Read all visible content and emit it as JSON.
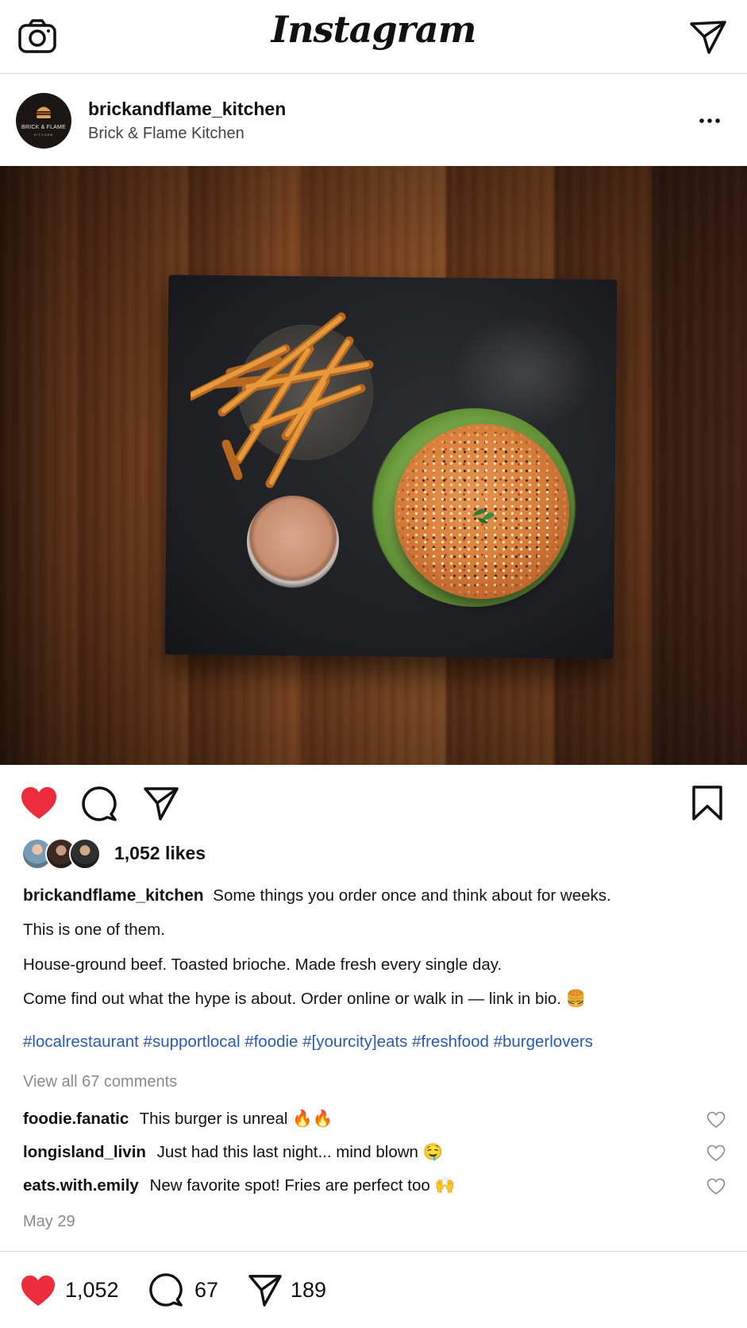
{
  "app": {
    "title": "Instagram"
  },
  "header": {
    "camera_icon": "camera-icon",
    "send_icon": "direct-send-icon"
  },
  "post": {
    "username": "brickandflame_kitchen",
    "display_name": "Brick & Flame Kitchen",
    "avatar_brand": "BRICK & FLAME",
    "avatar_brand_sub": "KITCHEN",
    "likes_text": "1,052 likes",
    "caption": {
      "username": "brickandflame_kitchen",
      "line1": "Some things you order once and think about for weeks.",
      "line2": "This is one of them.",
      "line3": "House-ground beef. Toasted brioche. Made fresh every single day.",
      "line4": "Come find out what the hype is about. Order online or walk in — link in bio. 🍔"
    },
    "hashtags": "#localrestaurant #supportlocal #foodie #[yourcity]eats #freshfood #burgerlovers",
    "view_all_comments": "View all 67 comments",
    "comments": [
      {
        "user": "foodie.fanatic",
        "text": "This burger is unreal 🔥🔥"
      },
      {
        "user": "longisland_livin",
        "text": "Just had this last night... mind blown 🤤"
      },
      {
        "user": "eats.with.emily",
        "text": "New favorite spot! Fries are perfect too 🙌"
      }
    ],
    "date": "May 29"
  },
  "bottom_bar": {
    "likes": "1,052",
    "comments": "67",
    "shares": "189"
  },
  "colors": {
    "like_red": "#ed2d3d",
    "hashtag_blue": "#2a5bb3",
    "muted_gray": "#8a8a8a"
  }
}
